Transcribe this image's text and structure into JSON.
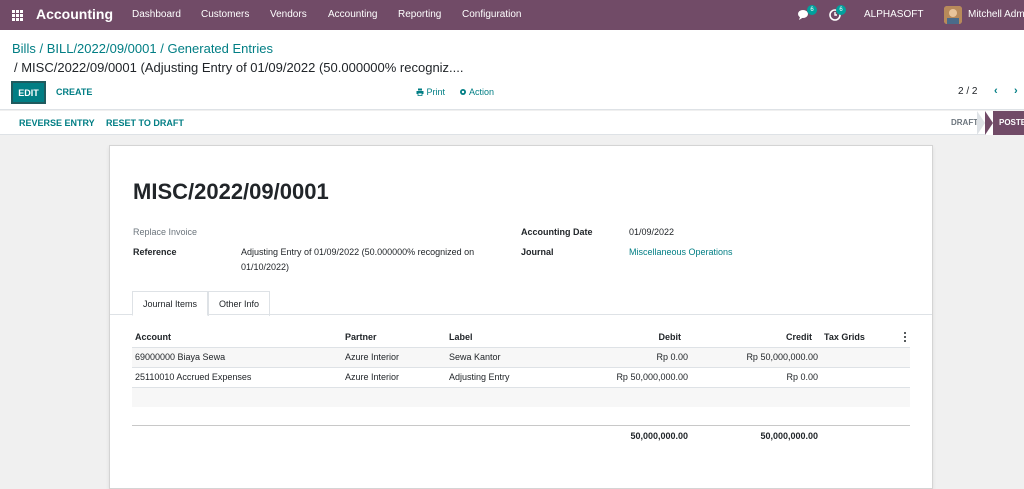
{
  "navbar": {
    "brand": "Accounting",
    "menu": [
      "Dashboard",
      "Customers",
      "Vendors",
      "Accounting",
      "Reporting",
      "Configuration"
    ],
    "messages_count": "6",
    "activities_count": "6",
    "company": "ALPHASOFT",
    "user": "Mitchell Admin"
  },
  "breadcrumb": {
    "items": [
      "Bills",
      "BILL/2022/09/0001",
      "Generated Entries"
    ],
    "current": "/ MISC/2022/09/0001 (Adjusting Entry of 01/09/2022 (50.000000% recogniz...."
  },
  "buttons": {
    "edit": "EDIT",
    "create": "CREATE",
    "print": "Print",
    "action": "Action"
  },
  "pager": {
    "value": "2 / 2"
  },
  "statusbar": {
    "reverse_entry": "REVERSE ENTRY",
    "reset_to_draft": "RESET TO DRAFT",
    "stages": [
      "DRAFT",
      "POSTE"
    ],
    "active_stage": "POSTE"
  },
  "record": {
    "name": "MISC/2022/09/0001",
    "replace_invoice_label": "Replace Invoice",
    "reference_label": "Reference",
    "reference_line1": "Adjusting Entry of 01/09/2022 (50.000000% recognized on",
    "reference_line2": "01/10/2022)",
    "accounting_date_label": "Accounting Date",
    "accounting_date": "01/09/2022",
    "journal_label": "Journal",
    "journal": "Miscellaneous Operations"
  },
  "tabs": [
    "Journal Items",
    "Other Info"
  ],
  "journal_items": {
    "headers": [
      "Account",
      "Partner",
      "Label",
      "Debit",
      "Credit",
      "Tax Grids"
    ],
    "rows": [
      {
        "account": "69000000 Biaya Sewa",
        "partner": "Azure Interior",
        "label": "Sewa Kantor",
        "debit": "Rp 0.00",
        "credit": "Rp 50,000,000.00"
      },
      {
        "account": "25110010 Accrued Expenses",
        "partner": "Azure Interior",
        "label": "Adjusting Entry",
        "debit": "Rp 50,000,000.00",
        "credit": "Rp 0.00"
      }
    ],
    "total_debit": "50,000,000.00",
    "total_credit": "50,000,000.00"
  },
  "colors": {
    "primary": "#714b67",
    "link": "#017e84"
  }
}
